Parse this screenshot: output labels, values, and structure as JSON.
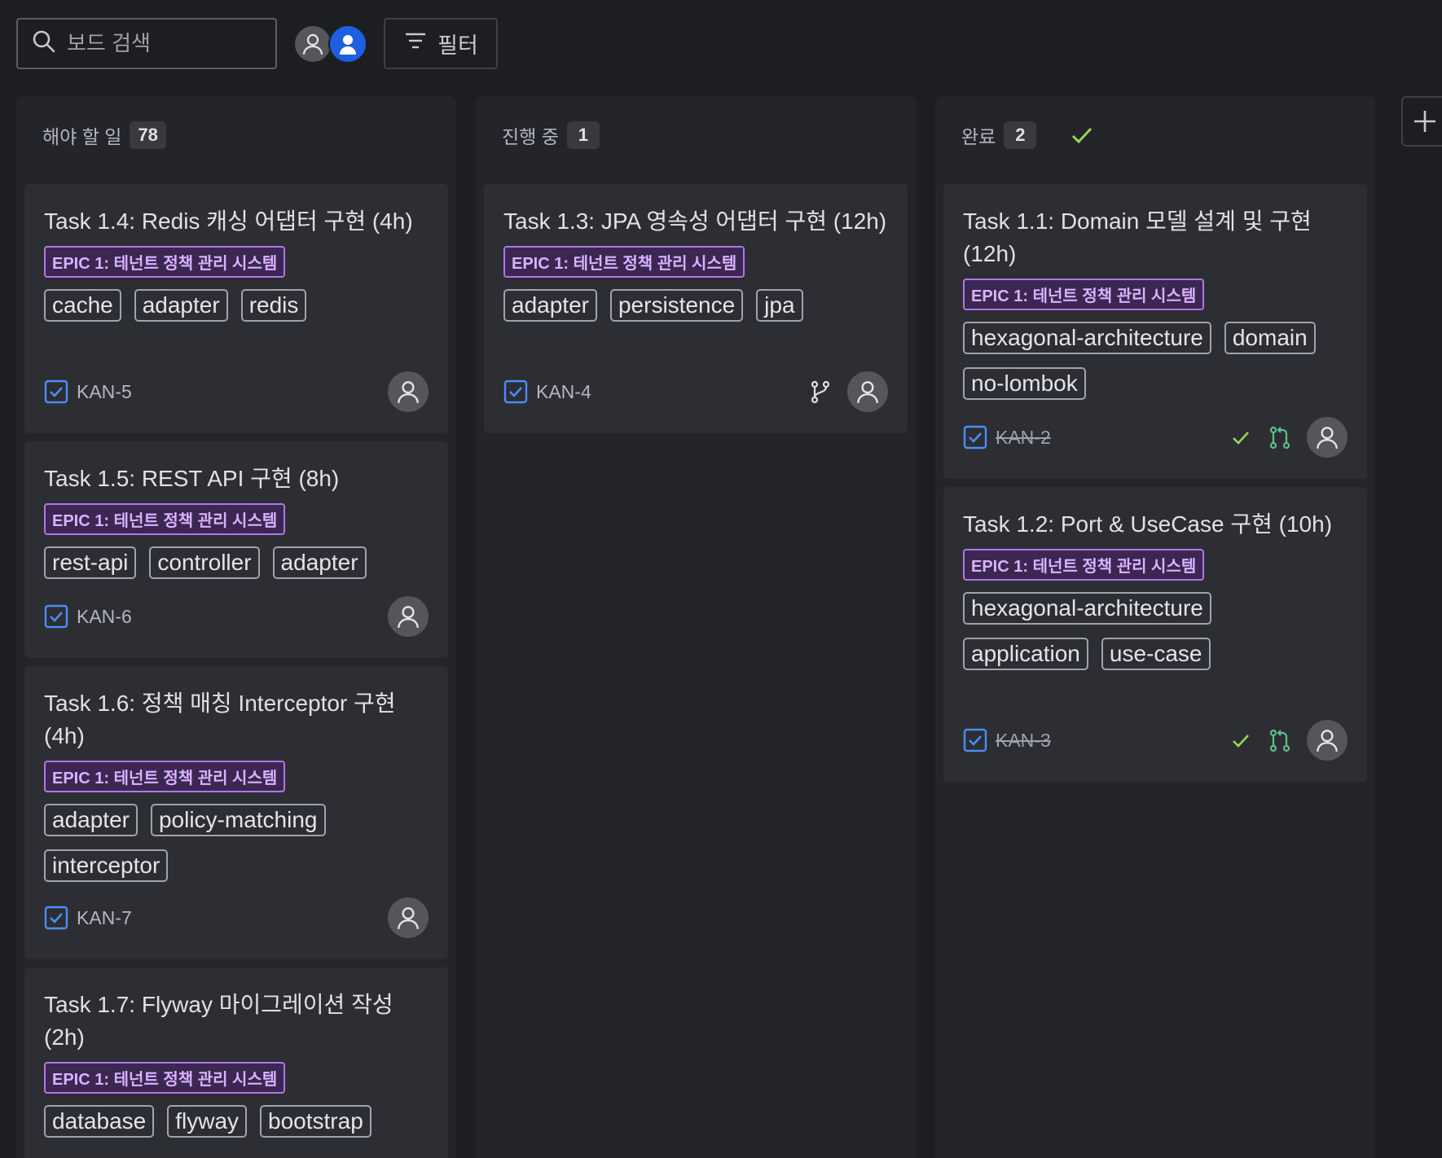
{
  "toolbar": {
    "search_placeholder": "보드 검색",
    "filter_label": "필터"
  },
  "colors": {
    "background": "#1d1e21",
    "column": "#23252a",
    "card": "#2c2e33",
    "epic_border": "#b076e8",
    "epic_text": "#d9b2ff",
    "checkbox": "#4c8df6",
    "done_check": "#9bd45a",
    "pr_merged": "#5cc08a",
    "avatar_active": "#1d5fe0"
  },
  "columns": [
    {
      "title": "해야 할 일",
      "count": "78",
      "cards": [
        {
          "title": "Task 1.4: Redis 캐싱 어댑터 구현 (4h)",
          "epic": "EPIC 1: 테넌트 정책 관리 시스템",
          "labels": [
            "cache",
            "adapter",
            "redis"
          ],
          "key": "KAN-5"
        },
        {
          "title": "Task 1.5: REST API 구현 (8h)",
          "epic": "EPIC 1: 테넌트 정책 관리 시스템",
          "labels": [
            "rest-api",
            "controller",
            "adapter"
          ],
          "key": "KAN-6"
        },
        {
          "title": "Task 1.6: 정책 매칭 Interceptor 구현 (4h)",
          "epic": "EPIC 1: 테넌트 정책 관리 시스템",
          "labels": [
            "adapter",
            "policy-matching",
            "interceptor"
          ],
          "key": "KAN-7"
        },
        {
          "title": "Task 1.7: Flyway 마이그레이션 작성 (2h)",
          "epic": "EPIC 1: 테넌트 정책 관리 시스템",
          "labels": [
            "database",
            "flyway",
            "bootstrap"
          ],
          "key": ""
        }
      ]
    },
    {
      "title": "진행 중",
      "count": "1",
      "cards": [
        {
          "title": "Task 1.3: JPA 영속성 어댑터 구현 (12h)",
          "epic": "EPIC 1: 테넌트 정책 관리 시스템",
          "labels": [
            "adapter",
            "persistence",
            "jpa"
          ],
          "key": "KAN-4",
          "icons": [
            "branch-icon"
          ]
        }
      ]
    },
    {
      "title": "완료",
      "count": "2",
      "cards": [
        {
          "title": "Task 1.1: Domain 모델 설계 및 구현 (12h)",
          "epic": "EPIC 1: 테넌트 정책 관리 시스템",
          "labels": [
            "hexagonal-architecture",
            "domain",
            "no-lombok"
          ],
          "key": "KAN-2",
          "icons": [
            "done-check-icon",
            "pull-request-icon"
          ]
        },
        {
          "title": "Task 1.2: Port & UseCase 구현 (10h)",
          "epic": "EPIC 1: 테넌트 정책 관리 시스템",
          "labels": [
            "hexagonal-architecture",
            "application",
            "use-case"
          ],
          "key": "KAN-3",
          "icons": [
            "done-check-icon",
            "pull-request-icon"
          ]
        }
      ]
    }
  ]
}
